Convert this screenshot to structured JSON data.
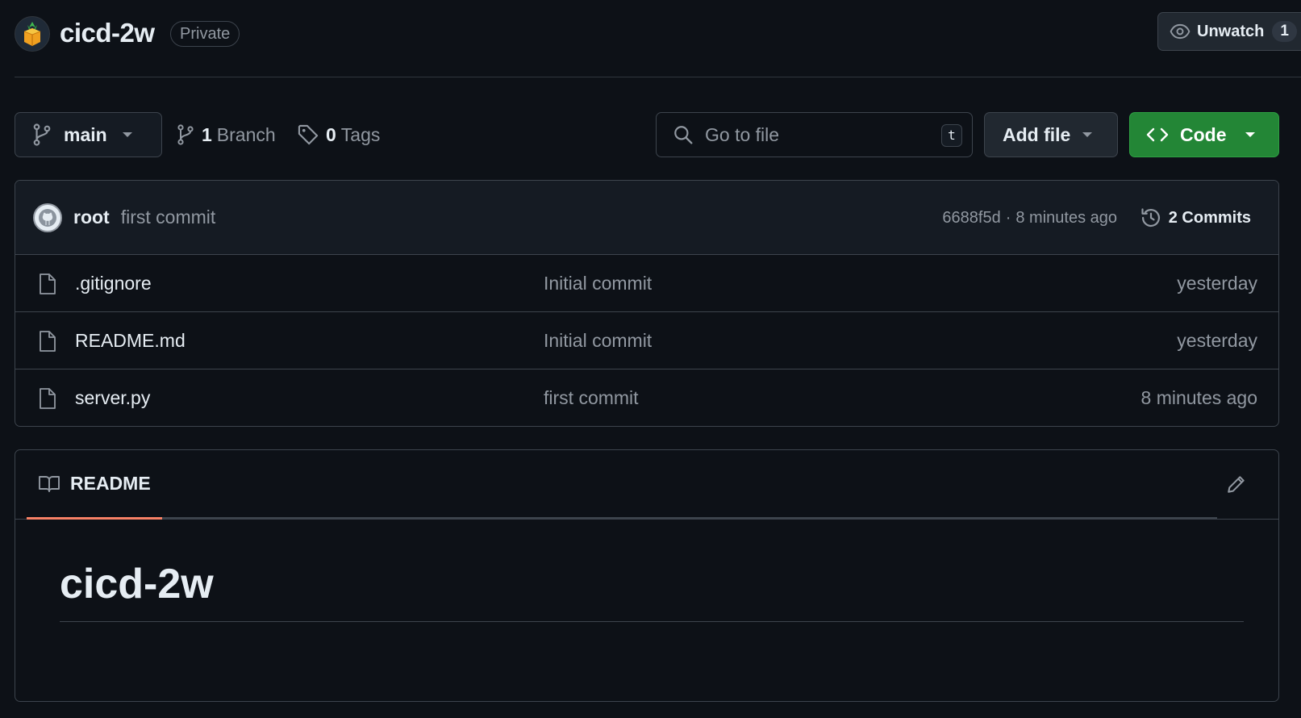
{
  "repo": {
    "name": "cicd-2w",
    "visibility": "Private"
  },
  "watch": {
    "label": "Unwatch",
    "count": "1"
  },
  "toolbar": {
    "branch": "main",
    "branches_count": "1",
    "branches_label": "Branch",
    "tags_count": "0",
    "tags_label": "Tags",
    "search_placeholder": "Go to file",
    "search_shortcut": "t",
    "add_file_label": "Add file",
    "code_label": "Code"
  },
  "latest_commit": {
    "author": "root",
    "message": "first commit",
    "hash": "6688f5d",
    "separator": "·",
    "time": "8 minutes ago",
    "commits_label": "2 Commits"
  },
  "files": [
    {
      "name": ".gitignore",
      "message": "Initial commit",
      "date": "yesterday"
    },
    {
      "name": "README.md",
      "message": "Initial commit",
      "date": "yesterday"
    },
    {
      "name": "server.py",
      "message": "first commit",
      "date": "8 minutes ago"
    }
  ],
  "readme": {
    "tab_label": "README",
    "heading": "cicd-2w"
  },
  "colors": {
    "background": "#0d1117",
    "border": "#3d444d",
    "code_button": "#238636",
    "tab_underline": "#f78166"
  }
}
